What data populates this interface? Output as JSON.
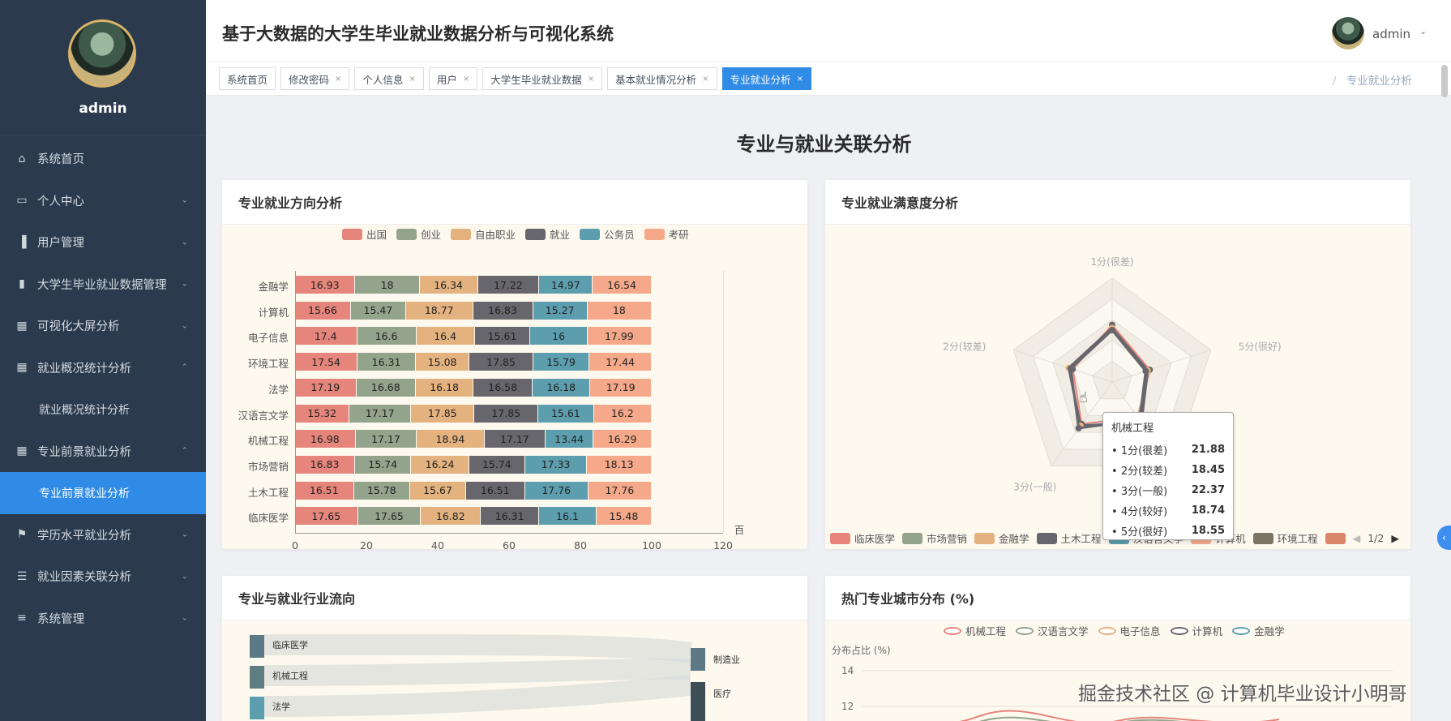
{
  "sidebar": {
    "username": "admin",
    "items": [
      {
        "label": "系统首页",
        "icon": "home-icon",
        "chev": ""
      },
      {
        "label": "个人中心",
        "icon": "id-card-icon",
        "chev": "⌄"
      },
      {
        "label": "用户管理",
        "icon": "book-icon",
        "chev": "⌄"
      },
      {
        "label": "大学生毕业就业数据管理",
        "icon": "bar-chart-icon",
        "chev": "⌄"
      },
      {
        "label": "可视化大屏分析",
        "icon": "grid-icon",
        "chev": "⌄"
      },
      {
        "label": "就业概况统计分析",
        "icon": "grid-icon",
        "chev": "⌃"
      },
      {
        "label": "就业概况统计分析",
        "icon": "",
        "chev": "",
        "sub": true
      },
      {
        "label": "专业前景就业分析",
        "icon": "grid-icon",
        "chev": "⌃"
      },
      {
        "label": "专业前景就业分析",
        "icon": "",
        "chev": "",
        "sub": true,
        "active": true
      },
      {
        "label": "学历水平就业分析",
        "icon": "flag-icon",
        "chev": "⌄"
      },
      {
        "label": "就业因素关联分析",
        "icon": "sliders-icon",
        "chev": "⌄"
      },
      {
        "label": "系统管理",
        "icon": "list-icon",
        "chev": "⌄"
      }
    ]
  },
  "header": {
    "title": "基于大数据的大学生毕业就业数据分析与可视化系统",
    "user": "admin"
  },
  "tabs": [
    {
      "label": "系统首页",
      "closable": false
    },
    {
      "label": "修改密码",
      "closable": true
    },
    {
      "label": "个人信息",
      "closable": true
    },
    {
      "label": "用户",
      "closable": true
    },
    {
      "label": "大学生毕业就业数据",
      "closable": true
    },
    {
      "label": "基本就业情况分析",
      "closable": true
    },
    {
      "label": "专业就业分析",
      "closable": true,
      "active": true
    }
  ],
  "breadcrumb": {
    "current": "专业就业分析"
  },
  "page": {
    "title": "专业与就业关联分析"
  },
  "cards": {
    "direction": "专业就业方向分析",
    "satisfaction": "专业就业满意度分析",
    "flow": "专业与就业行业流向",
    "city": "热门专业城市分布 (%)"
  },
  "chart_data": [
    {
      "type": "bar",
      "stacked": true,
      "orientation": "horizontal",
      "title": "专业就业方向分析",
      "categories": [
        "金融学",
        "计算机",
        "电子信息",
        "环境工程",
        "法学",
        "汉语言文学",
        "机械工程",
        "市场营销",
        "土木工程",
        "临床医学"
      ],
      "series": [
        {
          "name": "出国",
          "color": "#e5857b",
          "values": [
            16.93,
            15.66,
            17.4,
            17.54,
            17.19,
            15.32,
            16.98,
            16.83,
            16.51,
            17.65
          ]
        },
        {
          "name": "创业",
          "color": "#93a38c",
          "values": [
            18,
            15.47,
            16.6,
            16.31,
            16.68,
            17.17,
            17.17,
            15.74,
            15.78,
            17.65
          ]
        },
        {
          "name": "自由职业",
          "color": "#e3b27f",
          "values": [
            16.34,
            18.77,
            16.4,
            15.08,
            16.18,
            17.85,
            18.94,
            16.24,
            15.67,
            16.82
          ]
        },
        {
          "name": "就业",
          "color": "#67666c",
          "values": [
            17.22,
            16.83,
            15.61,
            17.85,
            16.58,
            17.85,
            17.17,
            15.74,
            16.51,
            16.31
          ]
        },
        {
          "name": "公务员",
          "color": "#5c9eae",
          "values": [
            14.97,
            15.27,
            16,
            15.79,
            16.18,
            15.61,
            13.44,
            17.33,
            17.76,
            16.1
          ]
        },
        {
          "name": "考研",
          "color": "#f5a98a",
          "values": [
            16.54,
            18,
            17.99,
            17.44,
            17.19,
            16.2,
            16.29,
            18.13,
            17.76,
            15.48
          ]
        }
      ],
      "xlim": [
        0,
        120
      ],
      "xticks": [
        0,
        20,
        40,
        60,
        80,
        100,
        120
      ],
      "xunit": "百"
    },
    {
      "type": "radar",
      "title": "专业就业满意度分析",
      "indicators": [
        "1分(很差)",
        "5分(很好)",
        "4分(较好)",
        "3分(一般)",
        "2分(较差)"
      ],
      "legend": [
        "临床医学",
        "市场营销",
        "金融学",
        "土木工程",
        "汉语言文学",
        "计算机",
        "环境工程"
      ],
      "legend_colors": [
        "#e5857b",
        "#93a38c",
        "#e3b27f",
        "#67666c",
        "#5c9eae",
        "#f5a98a",
        "#7d7563",
        "#d9866a"
      ],
      "legend_page": "1/2",
      "tooltip": {
        "series": "机械工程",
        "rows": [
          {
            "label": "1分(很差)",
            "value": "21.88"
          },
          {
            "label": "2分(较差)",
            "value": "18.45"
          },
          {
            "label": "3分(一般)",
            "value": "22.37"
          },
          {
            "label": "4分(较好)",
            "value": "18.74"
          },
          {
            "label": "5分(很好)",
            "value": "18.55"
          }
        ]
      }
    },
    {
      "type": "sankey",
      "title": "专业与就业行业流向",
      "sources": [
        "临床医学",
        "机械工程",
        "法学"
      ],
      "targets": [
        "制造业",
        "医疗"
      ]
    },
    {
      "type": "line",
      "title": "热门专业城市分布 (%)",
      "ylabel": "分布占比 (%)",
      "yticks": [
        14,
        12
      ],
      "series": [
        {
          "name": "机械工程",
          "color": "#e5857b"
        },
        {
          "name": "汉语言文学",
          "color": "#93a38c"
        },
        {
          "name": "电子信息",
          "color": "#e3b27f"
        },
        {
          "name": "计算机",
          "color": "#67666c"
        },
        {
          "name": "金融学",
          "color": "#5c9eae"
        }
      ]
    }
  ],
  "watermark": "掘金技术社区 @ 计算机毕业设计小明哥"
}
